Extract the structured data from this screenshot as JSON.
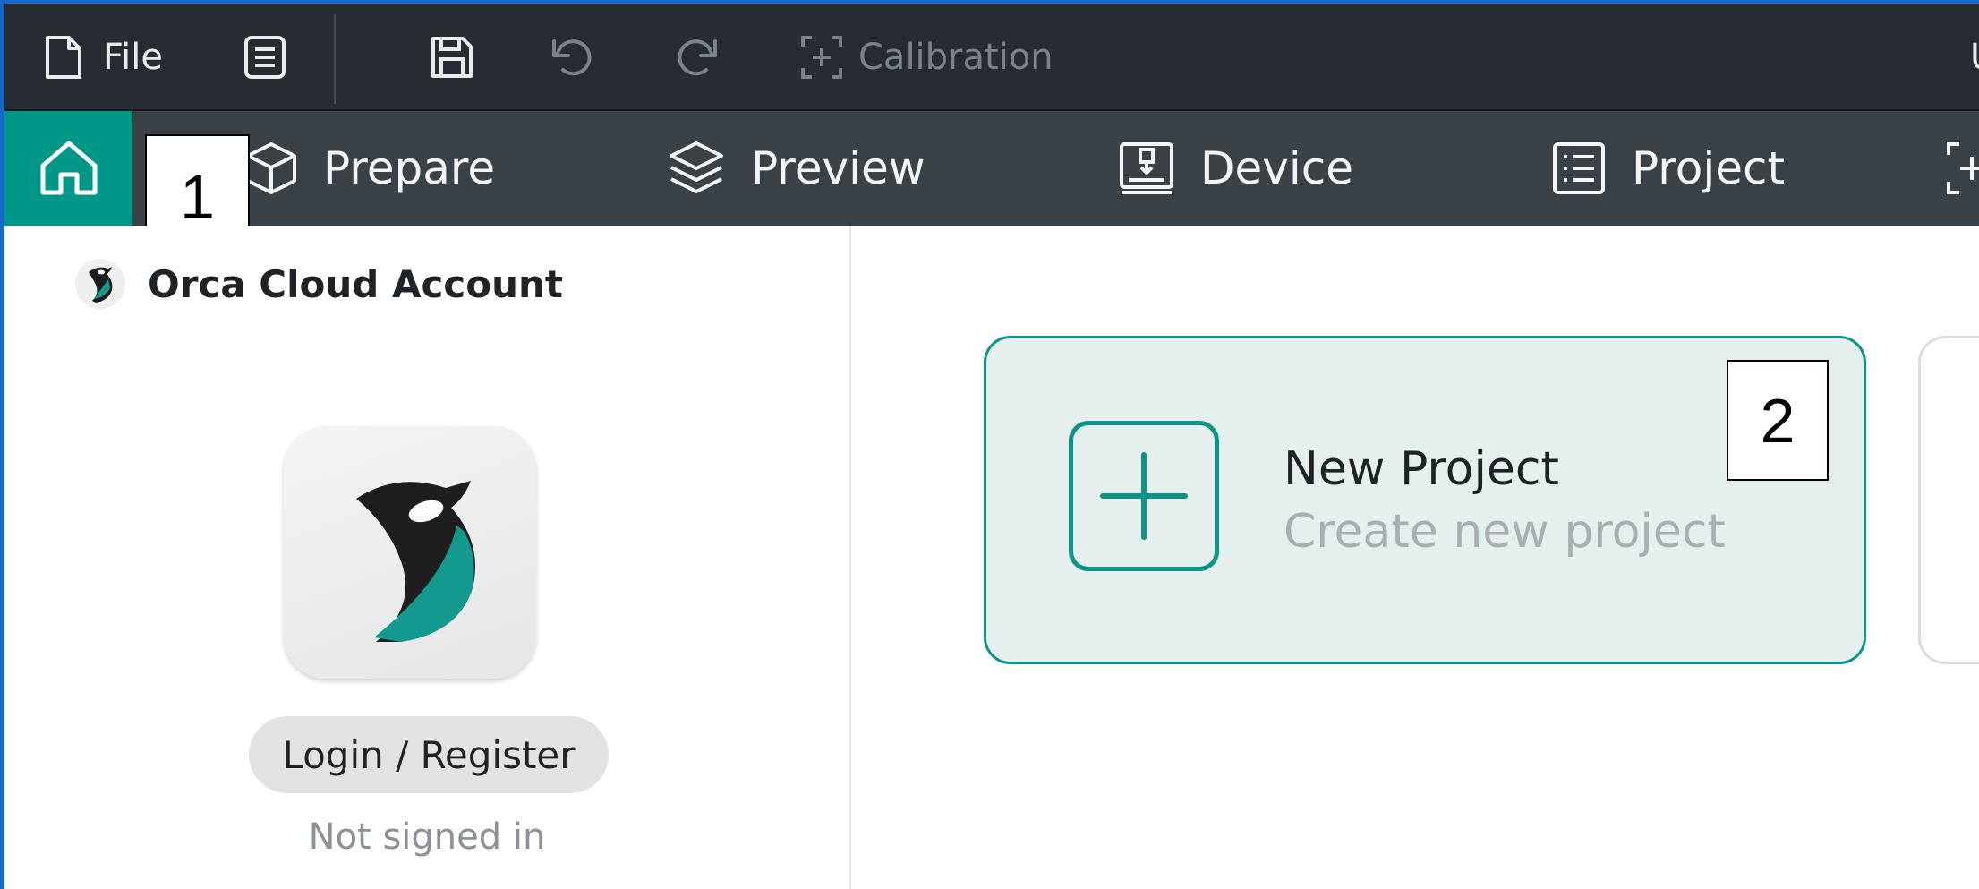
{
  "menubar": {
    "file_label": "File",
    "calibration_label": "Calibration",
    "right_clip_label": "U"
  },
  "tabs": [
    {
      "label": "Prepare",
      "icon": "cube-icon"
    },
    {
      "label": "Preview",
      "icon": "layers-icon"
    },
    {
      "label": "Device",
      "icon": "device-icon"
    },
    {
      "label": "Project",
      "icon": "list-icon"
    }
  ],
  "annotations": {
    "marker_1": "1",
    "marker_2": "2"
  },
  "account": {
    "title": "Orca Cloud Account",
    "login_label": "Login / Register",
    "status": "Not signed in"
  },
  "new_project": {
    "title": "New Project",
    "subtitle": "Create new project"
  },
  "colors": {
    "accent": "#009688",
    "card_border": "#0d9488",
    "menubar_bg": "#262c31",
    "tabbar_bg": "#3a4248",
    "window_border": "#1669c9"
  }
}
